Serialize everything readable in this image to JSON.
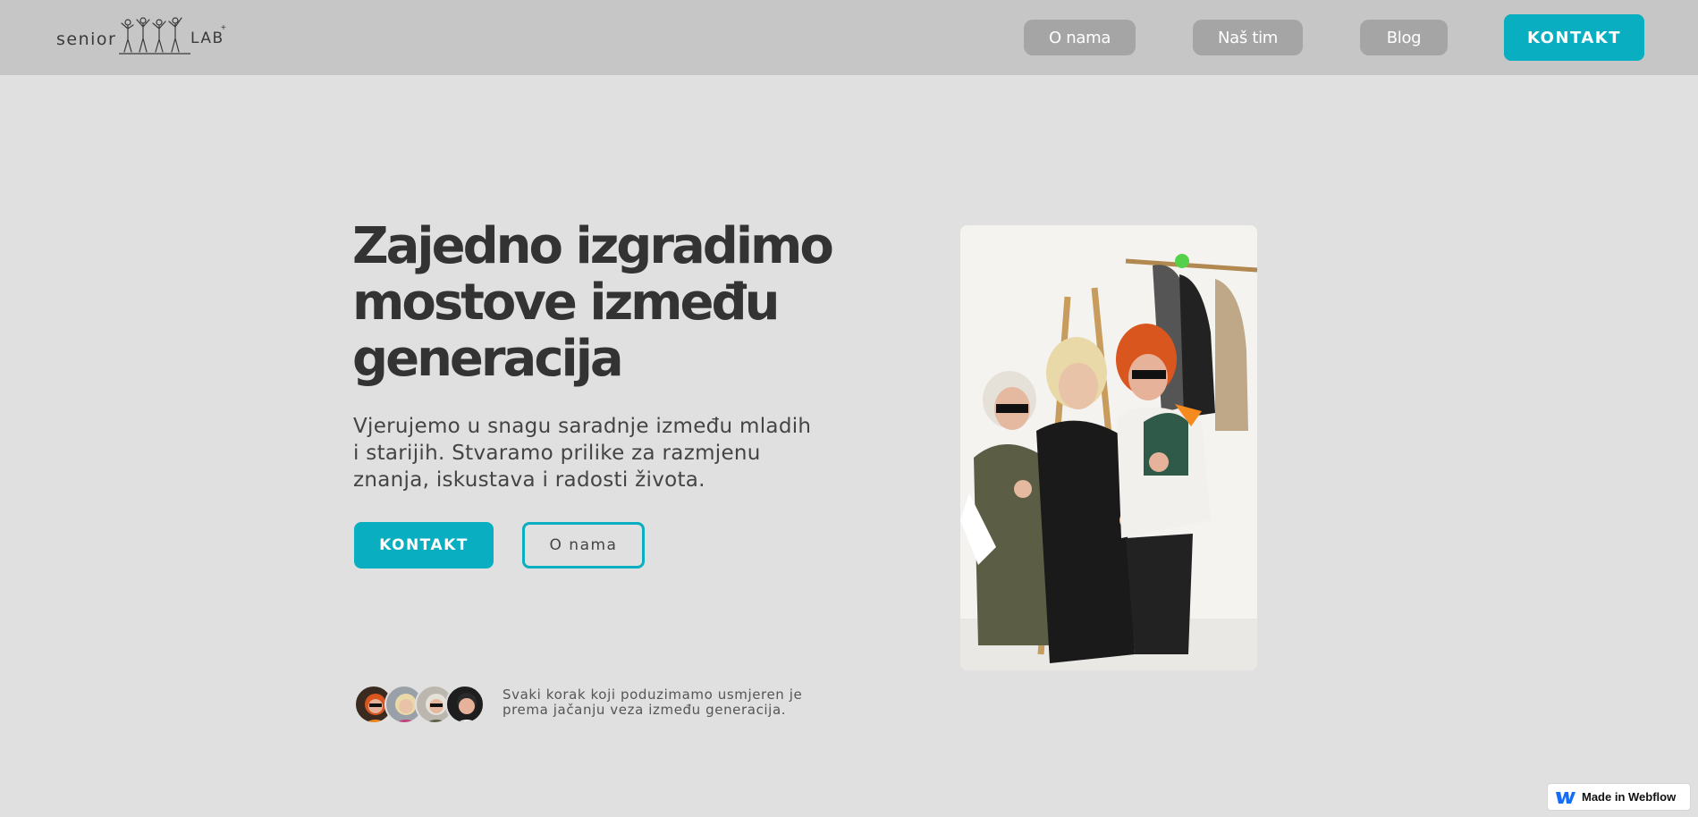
{
  "logo": {
    "word_left": "senior",
    "word_right": "LAB",
    "mark": "+"
  },
  "nav": {
    "links": [
      {
        "label": "O nama"
      },
      {
        "label": "Naš tim"
      },
      {
        "label": "Blog"
      }
    ],
    "cta_label": "KONTAKT"
  },
  "hero": {
    "title": "Zajedno izgradimo mostove između generacija",
    "text": "Vjerujemo u snagu saradnje između mladih i starijih. Stvaramo prilike za razmjenu znanja, iskustava i radosti života.",
    "primary_button": "KONTAKT",
    "secondary_button": "O nama",
    "caption": "Svaki korak koji poduzimamo usmjeren je prema jačanju veza između generacija."
  },
  "badge": {
    "label": "Made in Webflow",
    "icon": "webflow-icon"
  },
  "colors": {
    "accent": "#09aec0",
    "navbar": "#c6c6c6",
    "background": "#e0e0e0",
    "nav_button": "#a5a5a5"
  }
}
